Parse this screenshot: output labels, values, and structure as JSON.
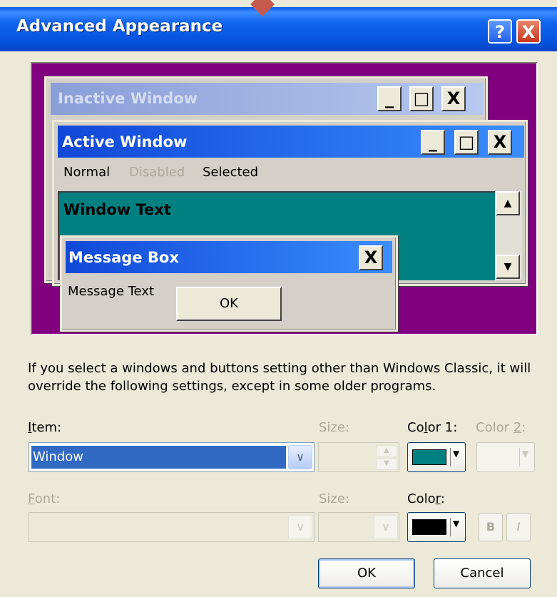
{
  "dialog": {
    "title": "Advanced Appearance",
    "help_glyph": "?",
    "close_glyph": "X"
  },
  "preview": {
    "inactive_title": "Inactive Window",
    "active_title": "Active Window",
    "caption_min": "_",
    "caption_max": "□",
    "caption_close": "X",
    "menu": [
      "Normal",
      "Disabled",
      "Selected"
    ],
    "window_text": "Window Text",
    "msgbox_title": "Message Box",
    "msgbox_text": "Message Text",
    "msgbox_ok": "OK",
    "scroll_up": "▲",
    "scroll_down": "▼"
  },
  "info_text": "If you select a windows and buttons setting other than Windows Classic, it will override the following settings, except in some older programs.",
  "item": {
    "label_pre": "",
    "label_u": "I",
    "label_post": "tem:",
    "value": "Window"
  },
  "size1": {
    "label": "Size:"
  },
  "color1": {
    "label_pre": "Co",
    "label_u": "l",
    "label_post": "or 1:",
    "swatch": "#008080"
  },
  "color2": {
    "label_pre": "Color ",
    "label_u": "2",
    "label_post": ":"
  },
  "font": {
    "label_pre": "",
    "label_u": "F",
    "label_post": "ont:"
  },
  "size2": {
    "label": "Size:"
  },
  "font_color": {
    "label_pre": "Colo",
    "label_u": "r",
    "label_post": ":",
    "swatch": "#000000"
  },
  "bold_label": "B",
  "italic_label": "I",
  "buttons": {
    "ok": "OK",
    "cancel": "Cancel"
  },
  "colors": {
    "title_blue": "#0656e2",
    "preview_bg": "#800080",
    "window_bg": "#008080",
    "selection": "#316ac5"
  }
}
